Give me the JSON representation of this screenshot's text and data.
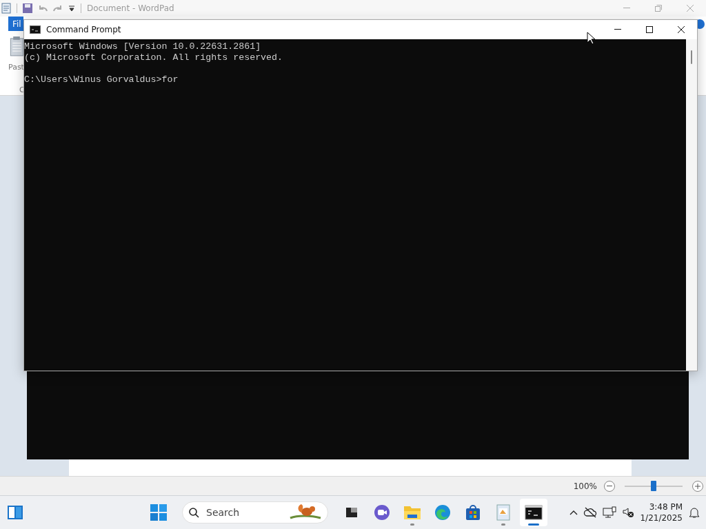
{
  "wordpad": {
    "title": "Document - WordPad",
    "file_tab": "Fil",
    "paste_label": "Past",
    "clipboard_label": "C",
    "zoom": "100%",
    "zoom_slider": {
      "level": 0.5
    }
  },
  "cmd": {
    "title": "Command Prompt",
    "banner": [
      "Microsoft Windows [Version 10.0.22631.2861]",
      "(c) Microsoft Corporation. All rights reserved."
    ],
    "prompt": "C:\\Users\\Winus Gorvaldus>for"
  },
  "taskbar": {
    "search_placeholder": "Search",
    "apps": [
      {
        "kind": "taskview",
        "running": false,
        "selected": false
      },
      {
        "kind": "chat",
        "running": false,
        "selected": false
      },
      {
        "kind": "explorer",
        "running": true,
        "selected": false
      },
      {
        "kind": "edge",
        "running": false,
        "selected": false
      },
      {
        "kind": "store",
        "running": false,
        "selected": false
      },
      {
        "kind": "wordpad",
        "running": true,
        "selected": false
      },
      {
        "kind": "terminal",
        "running": true,
        "selected": true
      }
    ],
    "time": "3:48 PM",
    "date": "1/21/2025"
  }
}
